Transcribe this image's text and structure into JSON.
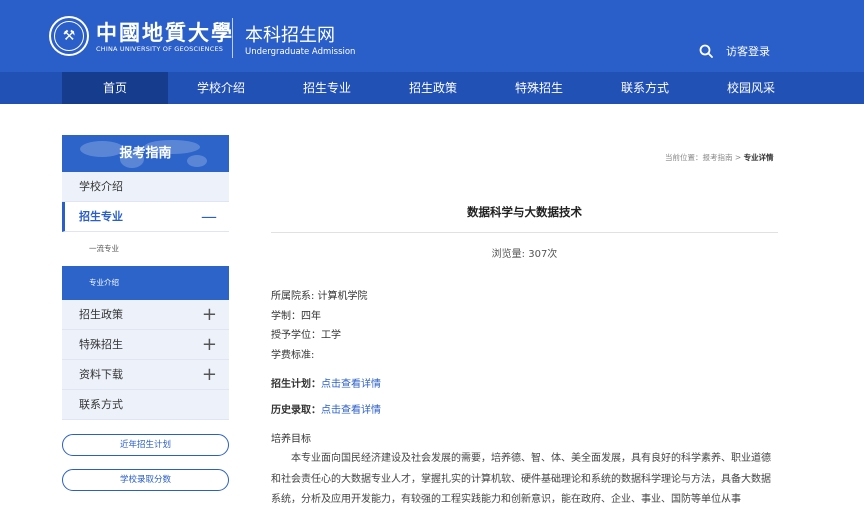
{
  "header": {
    "university_cn": "中國地質大學",
    "university_en": "CHINA UNIVERSITY OF GEOSCIENCES",
    "site_title": "本科招生网",
    "site_subtitle": "Undergraduate Admission",
    "visitor_login": "访客登录"
  },
  "nav": {
    "items": [
      {
        "label": "首页",
        "active": true
      },
      {
        "label": "学校介绍"
      },
      {
        "label": "招生专业"
      },
      {
        "label": "招生政策"
      },
      {
        "label": "特殊招生"
      },
      {
        "label": "联系方式"
      },
      {
        "label": "校园风采"
      }
    ]
  },
  "sidebar": {
    "title": "报考指南",
    "items": [
      {
        "label": "学校介绍"
      },
      {
        "label": "招生专业",
        "toggle": "—"
      },
      {
        "label": "一流专业"
      },
      {
        "label": "专业介绍"
      },
      {
        "label": "招生政策",
        "toggle": "+"
      },
      {
        "label": "特殊招生",
        "toggle": "+"
      },
      {
        "label": "资料下载",
        "toggle": "+"
      },
      {
        "label": "联系方式"
      }
    ],
    "buttons": [
      {
        "label": "近年招生计划"
      },
      {
        "label": "学校录取分数"
      }
    ]
  },
  "breadcrumb": {
    "prefix": "当前位置：",
    "parent": "报考指南",
    "separator": " > ",
    "current": "专业详情"
  },
  "article": {
    "title": "数据科学与大数据技术",
    "views": "浏览量: 307次",
    "info": [
      {
        "label": "所属院系:",
        "value": " 计算机学院"
      },
      {
        "label": "学制：",
        "value": "四年"
      },
      {
        "label": "授予学位：",
        "value": "工学"
      },
      {
        "label": "学费标准:",
        "value": ""
      }
    ],
    "plan_label": "招生计划：",
    "plan_link": "点击查看详情",
    "history_label": "历史录取：",
    "history_link": "点击查看详情",
    "section_title": "培养目标",
    "paragraph_lines": [
      "本专业面向国民经济建设及社会发展的需要，培养德、智、体、美全面发展，具有良好的科学素养、职业道德",
      "和社会责任心的大数据专业人才，掌握扎实的计算机软、硬件基础理论和系统的数据科学理论与方法，具备大数据",
      "系统，分析及应用开发能力，有较强的工程实践能力和创新意识，能在政府、企业、事业、国防等单位从事"
    ]
  },
  "colors": {
    "header_bg": "#2a5ec8",
    "nav_bg": "#2251b5",
    "nav_active": "#163c8e",
    "accent": "#2a5ec8"
  }
}
